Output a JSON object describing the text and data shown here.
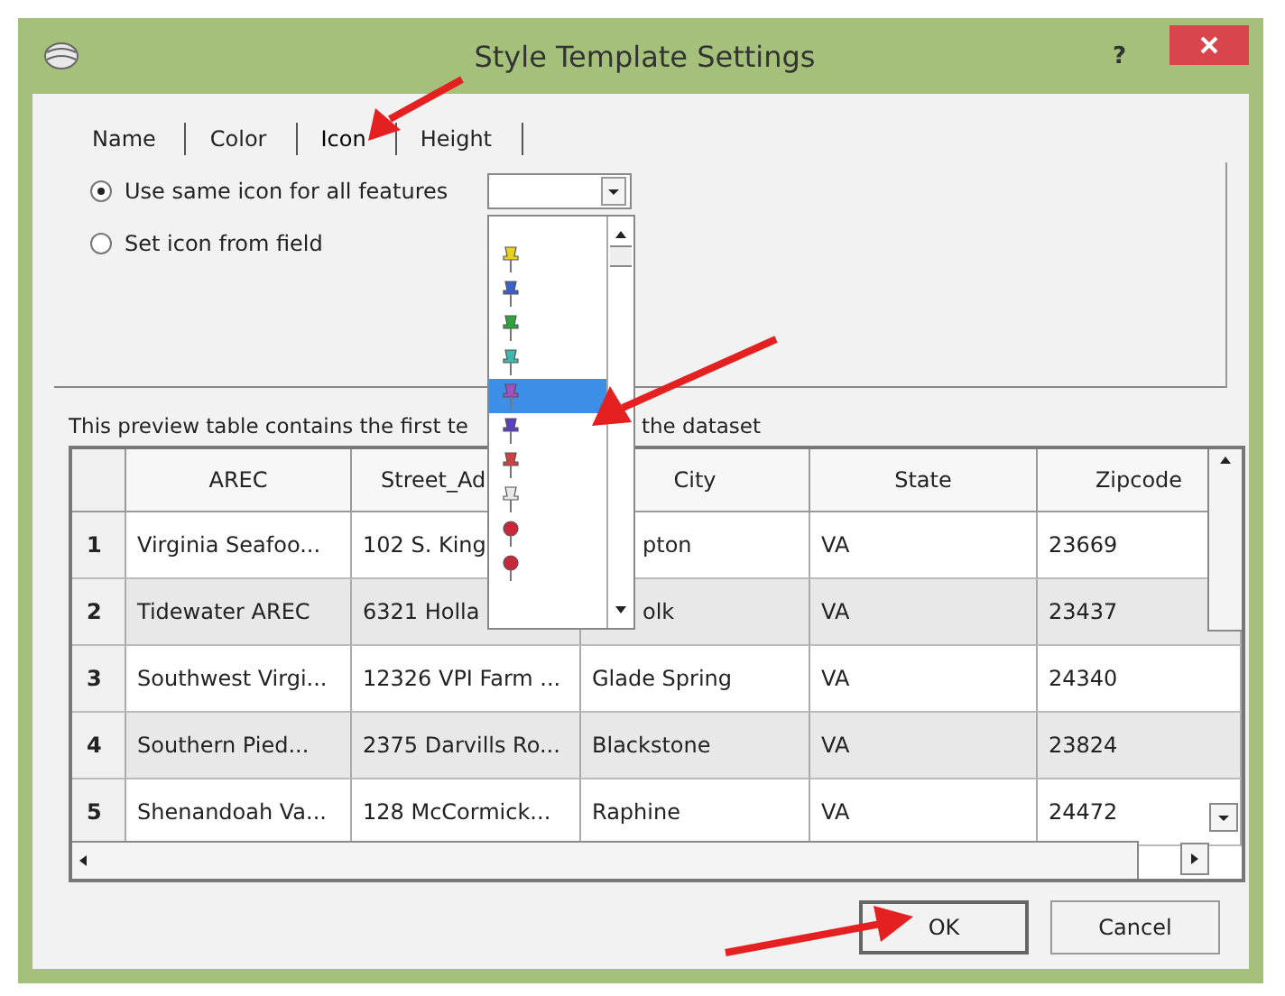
{
  "window": {
    "title": "Style Template Settings",
    "help": "?"
  },
  "tabs": [
    {
      "label": "Name",
      "selected": false
    },
    {
      "label": "Color",
      "selected": false
    },
    {
      "label": "Icon",
      "selected": true
    },
    {
      "label": "Height",
      "selected": false
    }
  ],
  "icon_options": [
    {
      "label": "Use same icon for all features",
      "selected": true
    },
    {
      "label": "Set icon from field",
      "selected": false
    }
  ],
  "icon_dropdown": {
    "expanded": true,
    "items": [
      {
        "kind": "pushpin",
        "color": "#e8d21c",
        "selected": false
      },
      {
        "kind": "pushpin",
        "color": "#3a5fc8",
        "selected": false
      },
      {
        "kind": "pushpin",
        "color": "#2fa43a",
        "selected": false
      },
      {
        "kind": "pushpin",
        "color": "#3fb8b0",
        "selected": false
      },
      {
        "kind": "pushpin",
        "color": "#a050c0",
        "selected": true
      },
      {
        "kind": "pushpin",
        "color": "#5b3fc0",
        "selected": false
      },
      {
        "kind": "pushpin",
        "color": "#d04040",
        "selected": false
      },
      {
        "kind": "pushpin",
        "color": "#e8e8e8",
        "selected": false
      },
      {
        "kind": "roundpin",
        "color": "#c8283c",
        "selected": false
      },
      {
        "kind": "roundpin",
        "color": "#c8283c",
        "selected": false
      }
    ]
  },
  "preview_note": {
    "before": "This preview table contains the first te",
    "after": "the dataset"
  },
  "table": {
    "columns": [
      {
        "text": "AREC"
      },
      {
        "text": "Street_Ad",
        "head_only": true
      },
      {
        "text": "City"
      },
      {
        "text": "State"
      },
      {
        "text": "Zipcode"
      }
    ],
    "rows": [
      {
        "number": "1",
        "cells": [
          {
            "text": "Virginia Seafoo..."
          },
          {
            "text": "102 S. King"
          },
          {
            "text": "pton",
            "tail_only": true
          },
          {
            "text": "VA"
          },
          {
            "text": "23669"
          }
        ]
      },
      {
        "number": "2",
        "cells": [
          {
            "text": "Tidewater AREC"
          },
          {
            "text": "6321 Holla"
          },
          {
            "text": "olk",
            "tail_only": true
          },
          {
            "text": "VA"
          },
          {
            "text": "23437"
          }
        ]
      },
      {
        "number": "3",
        "cells": [
          {
            "text": "Southwest Virgi..."
          },
          {
            "text": "12326 VPI Farm ..."
          },
          {
            "text": "Glade Spring"
          },
          {
            "text": "VA"
          },
          {
            "text": "24340"
          }
        ]
      },
      {
        "number": "4",
        "cells": [
          {
            "text": "Southern Pied..."
          },
          {
            "text": "2375 Darvills Ro..."
          },
          {
            "text": "Blackstone"
          },
          {
            "text": "VA"
          },
          {
            "text": "23824"
          }
        ]
      },
      {
        "number": "5",
        "cells": [
          {
            "text": "Shenandoah Va..."
          },
          {
            "text": "128 McCormick..."
          },
          {
            "text": "Raphine"
          },
          {
            "text": "VA"
          },
          {
            "text": "24472"
          }
        ]
      }
    ]
  },
  "buttons": [
    {
      "label": "OK",
      "kind": "default"
    },
    {
      "label": "Cancel",
      "kind": "normal"
    }
  ]
}
